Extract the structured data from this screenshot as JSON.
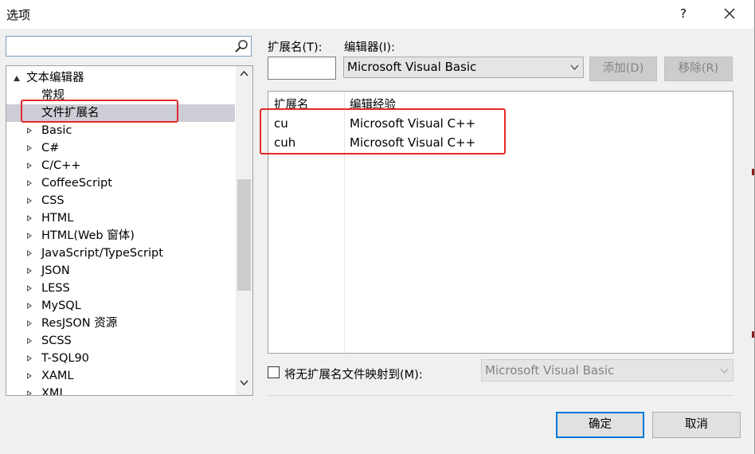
{
  "window": {
    "title": "选项",
    "help_label": "?",
    "close_icon": "close-icon"
  },
  "search": {
    "placeholder": "",
    "value": "",
    "icon": "search-icon"
  },
  "tree": {
    "root": {
      "label": "文本编辑器",
      "expanded": true
    },
    "items": [
      {
        "label": "常规",
        "has_children": false,
        "selected": false
      },
      {
        "label": "文件扩展名",
        "has_children": false,
        "selected": true
      },
      {
        "label": "Basic",
        "has_children": true
      },
      {
        "label": "C#",
        "has_children": true
      },
      {
        "label": "C/C++",
        "has_children": true
      },
      {
        "label": "CoffeeScript",
        "has_children": true
      },
      {
        "label": "CSS",
        "has_children": true
      },
      {
        "label": "HTML",
        "has_children": true
      },
      {
        "label": "HTML(Web 窗体)",
        "has_children": true
      },
      {
        "label": "JavaScript/TypeScript",
        "has_children": true
      },
      {
        "label": "JSON",
        "has_children": true
      },
      {
        "label": "LESS",
        "has_children": true
      },
      {
        "label": "MySQL",
        "has_children": true
      },
      {
        "label": "ResJSON 资源",
        "has_children": true
      },
      {
        "label": "SCSS",
        "has_children": true
      },
      {
        "label": "T-SQL90",
        "has_children": true
      },
      {
        "label": "XAML",
        "has_children": true
      },
      {
        "label": "XML",
        "has_children": true
      }
    ]
  },
  "form": {
    "extension_label": "扩展名(T):",
    "extension_value": "",
    "editor_label": "编辑器(I):",
    "editor_selected": "Microsoft Visual Basic",
    "add_label": "添加(D)",
    "remove_label": "移除(R)"
  },
  "mappings": {
    "columns": [
      "扩展名",
      "编辑经验"
    ],
    "rows": [
      {
        "extension": "cu",
        "editor": "Microsoft Visual C++"
      },
      {
        "extension": "cuh",
        "editor": "Microsoft Visual C++"
      }
    ]
  },
  "no_extension": {
    "checked": false,
    "label": "将无扩展名文件映射到(M):",
    "selected": "Microsoft Visual Basic"
  },
  "footer": {
    "ok_label": "确定",
    "cancel_label": "取消"
  },
  "colors": {
    "highlight_border": "#e52a2a",
    "selection": "#cdcdd6",
    "focus_border": "#0078d7"
  }
}
